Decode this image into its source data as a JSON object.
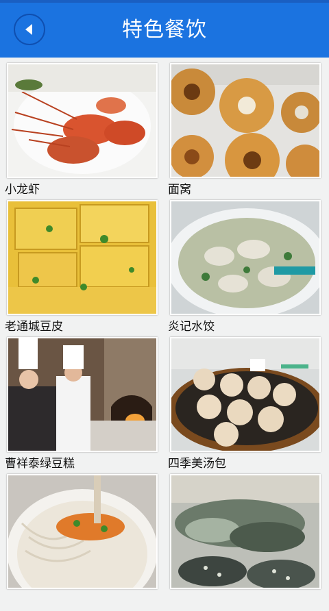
{
  "header": {
    "title": "特色餐饮",
    "back_icon": "back-arrow-icon"
  },
  "colors": {
    "header_bg": "#1b73e0",
    "header_text": "#ffffff",
    "page_bg": "#f1f2f2"
  },
  "items": [
    {
      "label": "小龙虾"
    },
    {
      "label": "面窝"
    },
    {
      "label": "老通城豆皮"
    },
    {
      "label": "炎记水饺"
    },
    {
      "label": "曹祥泰绿豆糕"
    },
    {
      "label": "四季美汤包"
    },
    {
      "label": ""
    },
    {
      "label": ""
    }
  ]
}
